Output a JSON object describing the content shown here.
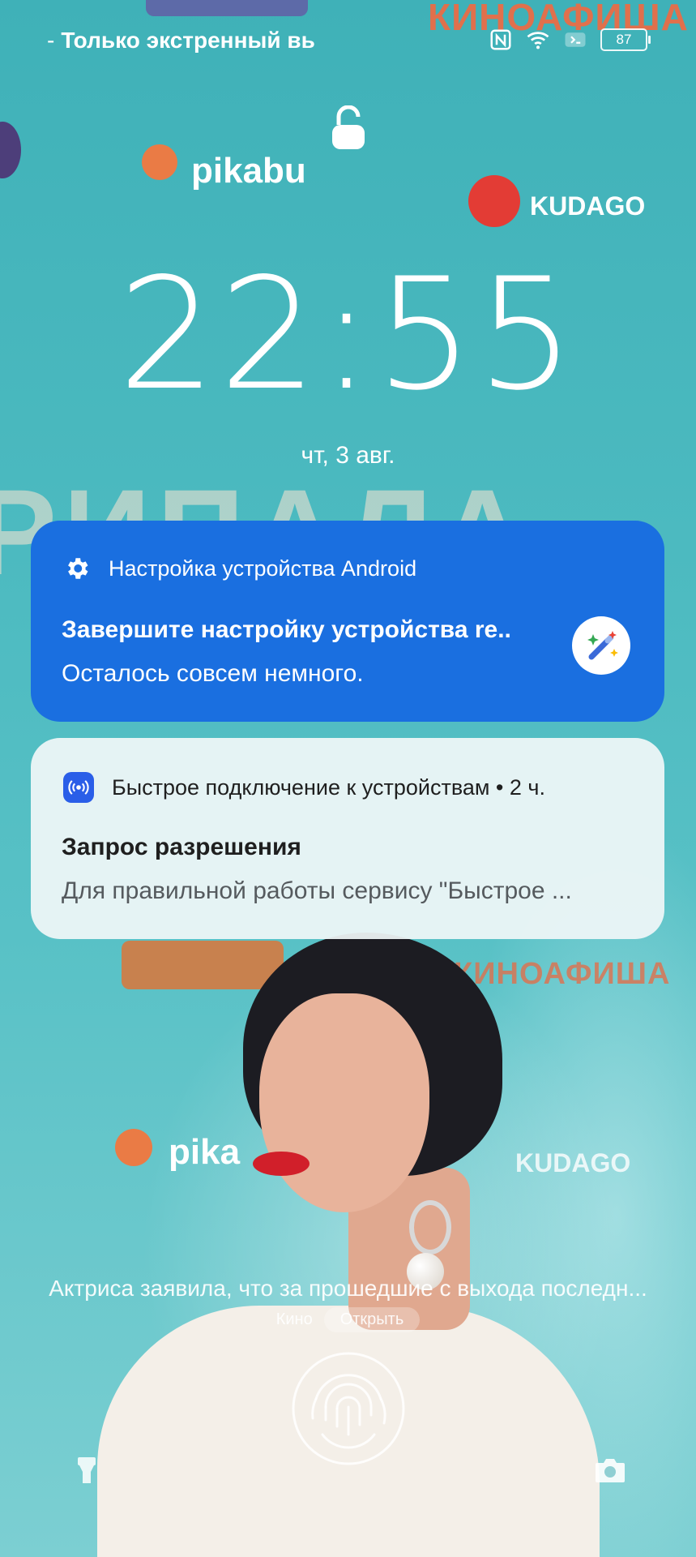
{
  "status_bar": {
    "carrier_text": "Только экстренный вы",
    "battery_level": "87",
    "icons": [
      "nfc-icon",
      "wifi-icon",
      "data-saver-icon",
      "battery-icon"
    ]
  },
  "lock_screen": {
    "time": "22:55",
    "date": "чт, 3 авг."
  },
  "notifications": [
    {
      "app_name": "Настройка устройства Android",
      "title": "Завершите настройку устройства re..",
      "body": "Осталось совсем немного.",
      "icon": "gear-icon",
      "badge_icon": "magic-wand-icon",
      "background": "#1a6fe0"
    },
    {
      "app_name": "Быстрое подключение к устройствам • 2 ч.",
      "title": "Запрос разрешения",
      "body": "Для правильной работы сервису \"Быстрое ...",
      "icon": "nearby-share-icon"
    }
  ],
  "wallpaper": {
    "brand_texts": [
      "КИНОАФИША",
      "pikabu",
      "KUDAGO",
      "КИНОАФИША",
      "pika",
      "KUDAGO"
    ],
    "big_text": "РИПАЛА"
  },
  "magazine": {
    "headline": "Актриса заявила, что за прошедшие с выхода последн...",
    "source": "Кино",
    "open_label": "Открыть"
  },
  "bottom": {
    "fingerprint_icon": "fingerprint-icon",
    "left_icon": "flashlight-icon",
    "right_icon": "camera-icon"
  }
}
